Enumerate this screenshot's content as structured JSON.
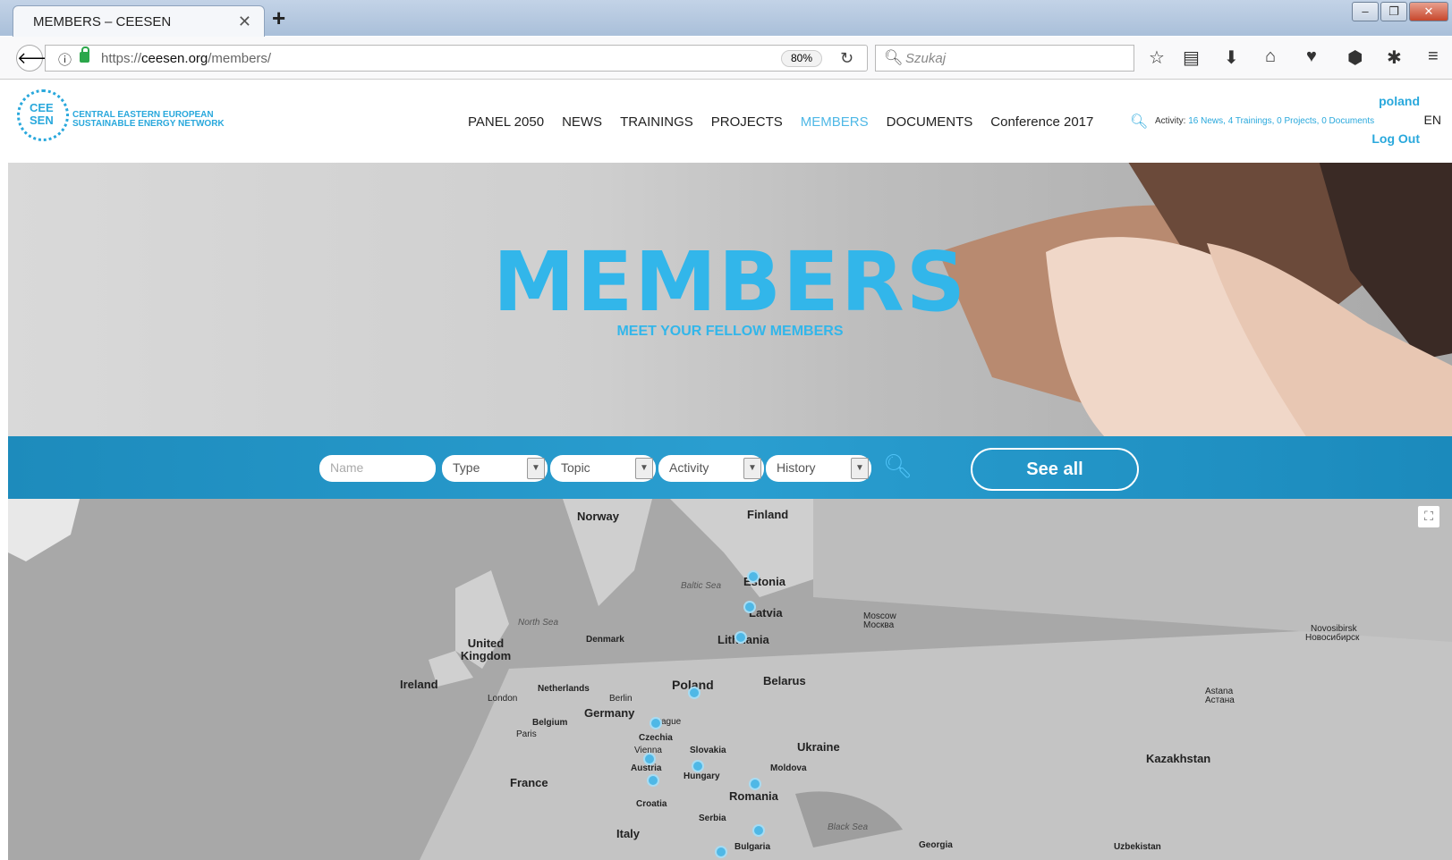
{
  "browser": {
    "tab_title": "MEMBERS – CEESEN",
    "url_scheme": "https://",
    "url_domain": "ceesen.org",
    "url_path": "/members/",
    "zoom": "80%",
    "search_placeholder": "Szukaj"
  },
  "site": {
    "logo_mark": "CEE SEN",
    "logo_line1": "CENTRAL EASTERN EUROPEAN",
    "logo_line2": "SUSTAINABLE ENERGY NETWORK",
    "nav": [
      "PANEL 2050",
      "NEWS",
      "TRAININGS",
      "PROJECTS",
      "MEMBERS",
      "DOCUMENTS",
      "Conference 2017"
    ],
    "active_nav": "MEMBERS",
    "activity_label": "Activity:",
    "activity_values": "16 News, 4 Trainings, 0 Projects, 0 Documents",
    "user": "poland",
    "lang": "EN",
    "logout": "Log Out"
  },
  "hero": {
    "title": "MEMBERS",
    "subtitle": "MEET YOUR FELLOW MEMBERS"
  },
  "filters": {
    "name_placeholder": "Name",
    "type": "Type",
    "topic": "Topic",
    "activity": "Activity",
    "history": "History",
    "see_all": "See all"
  },
  "map": {
    "countries": [
      "Norway",
      "Finland",
      "Estonia",
      "Latvia",
      "Lithuania",
      "Denmark",
      "United Kingdom",
      "Ireland",
      "Netherlands",
      "Poland",
      "Belarus",
      "Germany",
      "Belgium",
      "Czechia",
      "Slovakia",
      "Ukraine",
      "Austria",
      "Hungary",
      "Moldova",
      "France",
      "Romania",
      "Croatia",
      "Serbia",
      "Italy",
      "Kazakhstan",
      "Georgia",
      "Bulgaria",
      "Uzbekistan"
    ],
    "cities": [
      "London",
      "Berlin",
      "Paris",
      "Prague",
      "Vienna",
      "Moscow",
      "Москва",
      "Astana",
      "Астана",
      "Novosibirsk",
      "Новосибирск"
    ],
    "seas": [
      "Baltic Sea",
      "North Sea",
      "Black Sea"
    ],
    "colors": {
      "pin": "#4fb8e6",
      "accent": "#29a8dc"
    }
  }
}
